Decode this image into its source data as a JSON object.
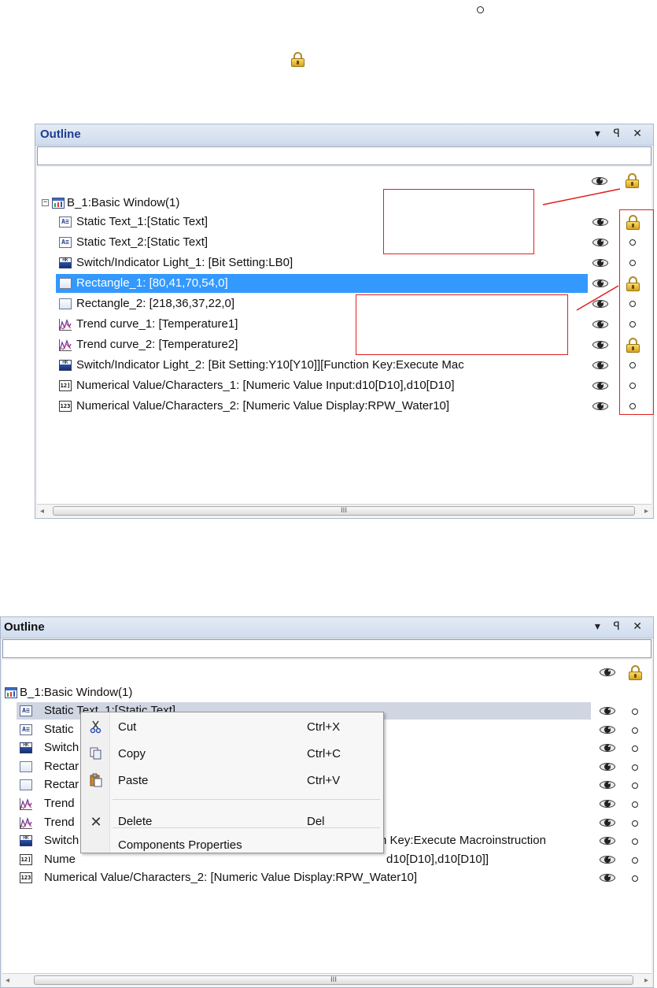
{
  "legend": {
    "ring": "ring-icon",
    "lock": "lock-icon"
  },
  "panel1": {
    "title": "Outline",
    "buttons": "▾ ꟼ ✕",
    "root": "B_1:Basic Window(1)",
    "items": [
      {
        "label": "Static Text_1:[Static Text]",
        "icon": "static-text-icon",
        "lock": true
      },
      {
        "label": "Static Text_2:[Static Text]",
        "icon": "static-text-icon",
        "lock": false
      },
      {
        "label": "Switch/Indicator Light_1: [Bit Setting:LB0]",
        "icon": "switch-indicator-icon",
        "lock": false
      },
      {
        "label": "Rectangle_1: [80,41,70,54,0]",
        "icon": "rectangle-icon",
        "lock": true,
        "selected": true
      },
      {
        "label": "Rectangle_2: [218,36,37,22,0]",
        "icon": "rectangle-icon",
        "lock": false
      },
      {
        "label": "Trend curve_1: [Temperature1]",
        "icon": "trend-curve-icon",
        "lock": false
      },
      {
        "label": "Trend curve_2: [Temperature2]",
        "icon": "trend-curve-icon",
        "lock": true
      },
      {
        "label": "Switch/Indicator Light_2: [Bit Setting:Y10[Y10]][Function Key:Execute Mac",
        "icon": "switch-indicator-icon",
        "lock": false
      },
      {
        "label": "Numerical Value/Characters_1: [Numeric Value Input:d10[D10],d10[D10]",
        "icon": "numeric-input-icon",
        "lock": false
      },
      {
        "label": "Numerical Value/Characters_2: [Numeric Value Display:RPW_Water10]",
        "icon": "numeric-display-icon",
        "lock": false
      }
    ],
    "scroll_grip": "III"
  },
  "panel2": {
    "title": "Outline",
    "root": "B_1:Basic Window(1)",
    "items": [
      {
        "label": "Static Text_1:[Static Text]"
      },
      {
        "label": "Static"
      },
      {
        "label": "Switch"
      },
      {
        "label": "Rectar"
      },
      {
        "label": "Rectar"
      },
      {
        "label": "Trend"
      },
      {
        "label": "Trend"
      },
      {
        "label": "Switch",
        "tail": "n Key:Execute Macroinstruction"
      },
      {
        "label": "Nume",
        "tail": "d10[D10],d10[D10]]"
      },
      {
        "label": "Numerical Value/Characters_2: [Numeric Value Display:RPW_Water10]"
      }
    ],
    "scroll_grip": "III"
  },
  "context_menu": {
    "items": [
      {
        "label": "Cut",
        "shortcut": "Ctrl+X",
        "icon": "scissors-icon"
      },
      {
        "label": "Copy",
        "shortcut": "Ctrl+C",
        "icon": "copy-icon"
      },
      {
        "label": "Paste",
        "shortcut": "Ctrl+V",
        "icon": "paste-icon"
      },
      {
        "label": "Delete",
        "shortcut": "Del",
        "icon": "delete-x-icon"
      },
      {
        "label": "Components Properties",
        "shortcut": ""
      }
    ]
  },
  "colors": {
    "selection_blue": "#3399ff",
    "annotation_red": "#e02020",
    "title_blue": "#1f3c8f"
  }
}
